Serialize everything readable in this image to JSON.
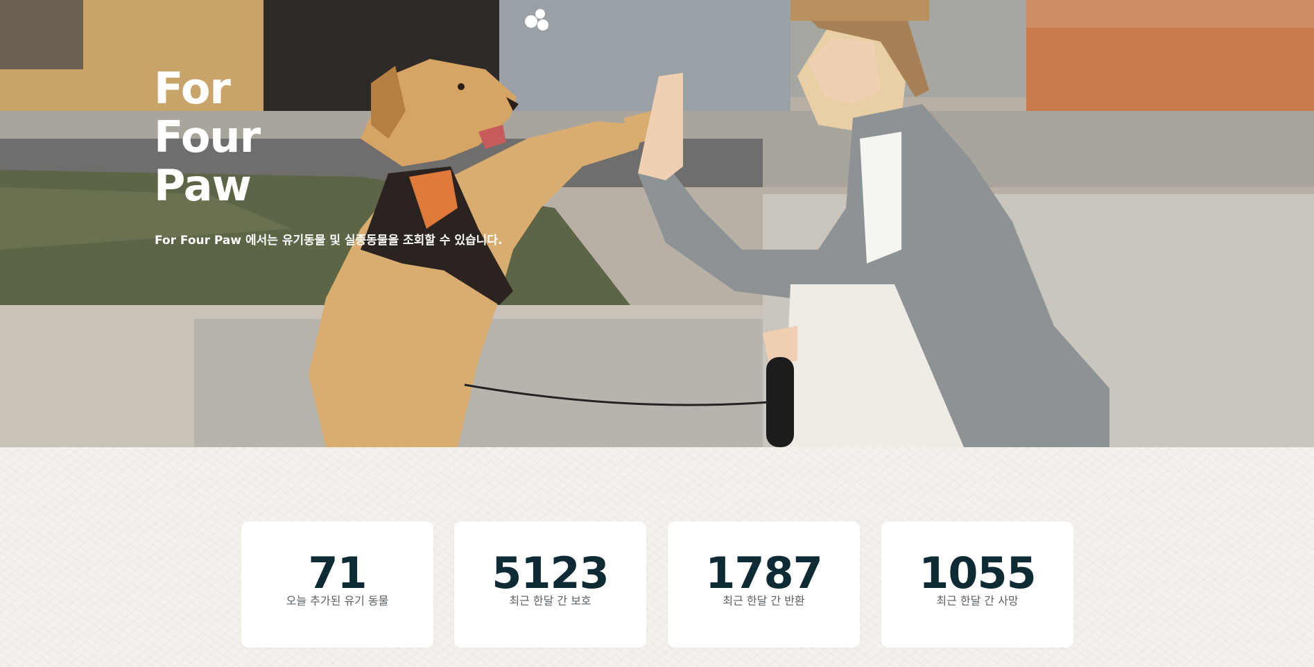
{
  "hero": {
    "title_lines": [
      "For",
      "Four",
      "Paw"
    ],
    "subtitle": "For Four Paw 에서는 유기동물 및 실종동물을 조회할 수 있습니다.",
    "logo_icon": "paw-logo-icon"
  },
  "stats": [
    {
      "value": "71",
      "label": "오늘 추가된 유기 동물"
    },
    {
      "value": "5123",
      "label": "최근 한달 간 보호"
    },
    {
      "value": "1787",
      "label": "최근 한달 간 반환"
    },
    {
      "value": "1055",
      "label": "최근 한달 간 사망"
    }
  ],
  "colors": {
    "stat_number": "#0e2a35",
    "stat_label": "#5a5f63",
    "stats_background": "#f4f1ec",
    "card_background": "#ffffff",
    "hero_text": "#ffffff"
  }
}
